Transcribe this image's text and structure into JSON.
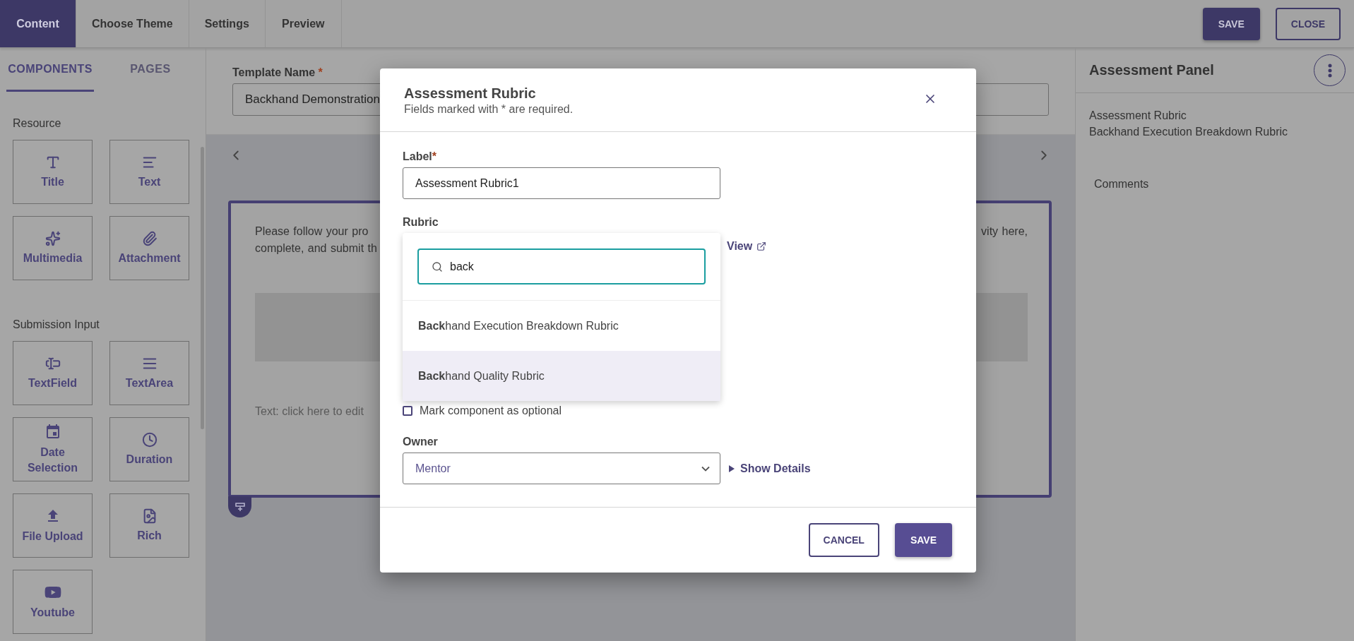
{
  "top_tabs": [
    {
      "label": "Content",
      "selected": true
    },
    {
      "label": "Choose Theme",
      "selected": false
    },
    {
      "label": "Settings",
      "selected": false
    },
    {
      "label": "Preview",
      "selected": false
    }
  ],
  "top_actions": {
    "save": "SAVE",
    "close": "CLOSE"
  },
  "sidebar": {
    "tabs": [
      {
        "label": "COMPONENTS",
        "selected": true
      },
      {
        "label": "PAGES",
        "selected": false
      }
    ],
    "sections": [
      {
        "title": "Resource",
        "items": [
          {
            "label": "Title",
            "kind": "title"
          },
          {
            "label": "Text",
            "kind": "text"
          },
          {
            "label": "Multimedia",
            "kind": "multimedia"
          },
          {
            "label": "Attachment",
            "kind": "attachment"
          }
        ]
      },
      {
        "title": "Submission Input",
        "items": [
          {
            "label": "TextField",
            "kind": "textfield"
          },
          {
            "label": "TextArea",
            "kind": "textarea"
          },
          {
            "label": "Date Selection",
            "kind": "date"
          },
          {
            "label": "Duration",
            "kind": "duration"
          },
          {
            "label": "File Upload",
            "kind": "upload"
          },
          {
            "label": "Rich",
            "kind": "rich"
          },
          {
            "label": "Youtube",
            "kind": "youtube"
          }
        ]
      }
    ]
  },
  "editor": {
    "template_name_label": "Template Name",
    "required_mark": "*",
    "template_name_value": "Backhand Demonstration",
    "card": {
      "text_left": [
        "Please follow your pro",
        "complete, and submit th"
      ],
      "text_right": [
        "vity here,"
      ],
      "placeholder": "Text: click here to edit"
    }
  },
  "assessment_panel": {
    "title": "Assessment Panel",
    "field_label": "Assessment Rubric",
    "field_value": "Backhand Execution Breakdown Rubric",
    "comments_label": "Comments"
  },
  "modal": {
    "title": "Assessment Rubric",
    "subtitle": "Fields marked with * are required.",
    "label_field": {
      "label": "Label",
      "required_mark": "*",
      "value": "Assessment Rubric1"
    },
    "rubric": {
      "label": "Rubric",
      "view_link": "View",
      "search": {
        "value": "back"
      },
      "options": [
        {
          "text": "**Back**hand Execution Breakdown Rubric",
          "selected": false
        },
        {
          "text": "**Back**hand Quality Rubric",
          "selected": true
        }
      ]
    },
    "optional": {
      "label": "Mark component as optional",
      "checked": false
    },
    "owner": {
      "label": "Owner",
      "value": "Mentor",
      "details_link": "Show Details"
    },
    "buttons": {
      "cancel": "CANCEL",
      "save": "SAVE"
    }
  }
}
